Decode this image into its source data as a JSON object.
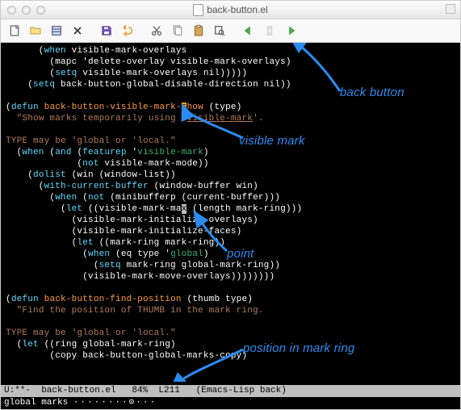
{
  "window": {
    "title": "back-button.el"
  },
  "toolbar": {
    "items": [
      "new",
      "open",
      "save-folder",
      "close",
      "save",
      "undo",
      "cut",
      "copy",
      "paste",
      "search",
      "back",
      "bookmark",
      "forward"
    ]
  },
  "code": {
    "l1a": "      (",
    "l1b": "when",
    "l1c": " visible-mark-overlays",
    "l2a": "        (mapc 'delete-overlay visible-mark-overlays)",
    "l3a": "        (",
    "l3b": "setq",
    "l3c": " visible-mark-overlays nil)))))",
    "l4a": "    (",
    "l4b": "setq",
    "l4c": " back-button-global-disable-direction nil))",
    "l5": "",
    "l6a": "(",
    "l6b": "defun",
    "l6c": " ",
    "l6d": "back-button-visible-mark-",
    "l6e": "s",
    "l6f": "how",
    "l6g": " (type)",
    "l7a": "  ",
    "l7b": "\"Show marks temporarily using `",
    "l7c": "visible-mark",
    "l7d": "'.",
    "l8": "",
    "l9": "TYPE may be 'global or 'local.\"",
    "l10a": "  (",
    "l10b": "when",
    "l10c": " (",
    "l10d": "and",
    "l10e": " (",
    "l10f": "featurep",
    "l10g": " '",
    "l10h": "visible-mark",
    "l10i": ")",
    "l11a": "             (",
    "l11b": "not",
    "l11c": " visible-mark-mode))",
    "l12a": "    (",
    "l12b": "dolist",
    "l12c": " (win (window-list))",
    "l13a": "      (",
    "l13b": "with-current-buffer",
    "l13c": " (window-buffer win)",
    "l14a": "        (",
    "l14b": "when",
    "l14c": " (",
    "l14d": "not",
    "l14e": " (minibufferp (current-buffer)))",
    "l15a": "          (",
    "l15b": "let",
    "l15c": " ((visible-mark-ma",
    "l15d": "x",
    "l15e": " (length mark-ring)))",
    "l16": "            (visible-mark-initialize-overlays)",
    "l17": "            (visible-mark-initialize-faces)",
    "l18a": "            (",
    "l18b": "let",
    "l18c": " ((mark-ring mark-ring))",
    "l19a": "              (",
    "l19b": "when",
    "l19c": " (eq type '",
    "l19d": "global",
    "l19e": ")",
    "l20a": "                (",
    "l20b": "setq",
    "l20c": " mark-ring global-mark-ring))",
    "l21": "              (visible-mark-move-overlays))))))))",
    "l22": "",
    "l23a": "(",
    "l23b": "defun",
    "l23c": " ",
    "l23d": "back-button-find-position",
    "l23e": " (thumb type)",
    "l24a": "  ",
    "l24b": "\"Find the position of THUMB in the mark ring.",
    "l25": "",
    "l26": "TYPE may be 'global or 'local.\"",
    "l27a": "  (",
    "l27b": "let",
    "l27c": " ((ring global-mark-ring)",
    "l28": "        (copy back-button-global-marks-copy)"
  },
  "modeline": {
    "left": "U:**-  back-button.el   84%  L211   (Emacs-Lisp back)"
  },
  "minibuffer": {
    "label": "global marks ",
    "ring": "········⊙···"
  },
  "annotations": {
    "back_button": "back button",
    "visible_mark": "visible mark",
    "point": "point",
    "position": "position in mark ring"
  }
}
